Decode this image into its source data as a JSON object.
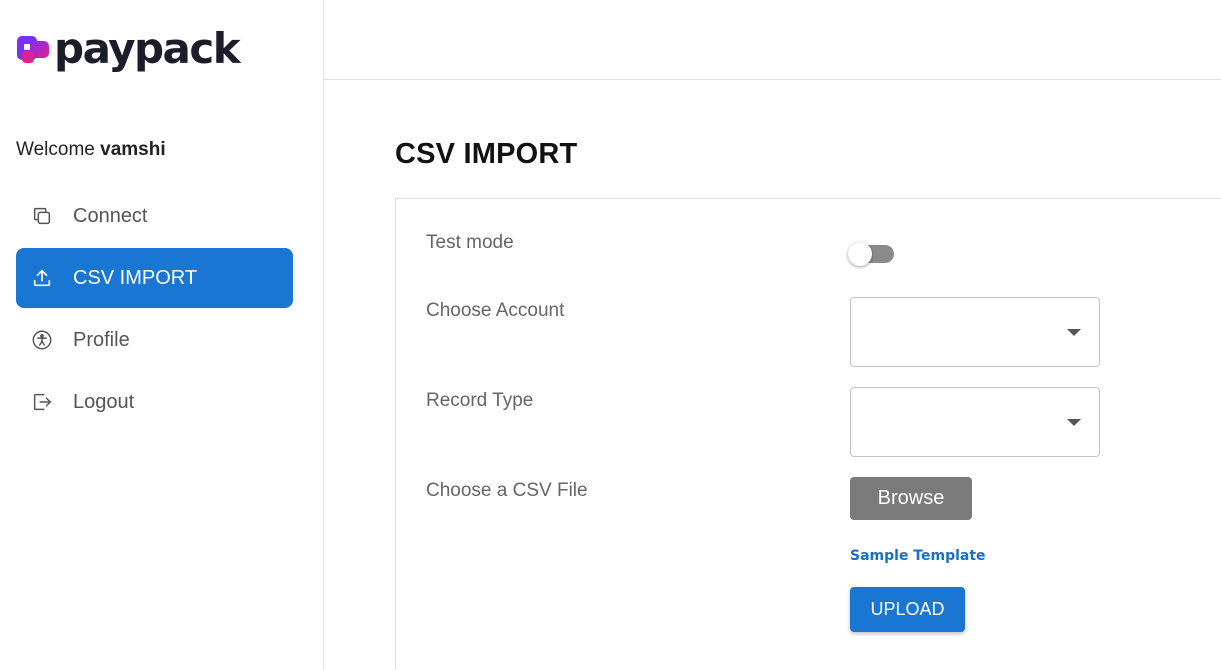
{
  "app": {
    "brand": "paypack"
  },
  "sidebar": {
    "welcome_prefix": "Welcome",
    "username": "vamshi",
    "items": [
      {
        "label": "Connect",
        "icon": "copy-icon",
        "active": false
      },
      {
        "label": "CSV IMPORT",
        "icon": "upload-icon",
        "active": true
      },
      {
        "label": "Profile",
        "icon": "accessibility-icon",
        "active": false
      },
      {
        "label": "Logout",
        "icon": "logout-icon",
        "active": false
      }
    ]
  },
  "main": {
    "title": "CSV IMPORT",
    "form": {
      "test_mode_label": "Test mode",
      "test_mode_on": false,
      "account_label": "Choose Account",
      "account_value": "",
      "record_type_label": "Record Type",
      "record_type_value": "",
      "file_label": "Choose a CSV File",
      "browse_label": "Browse",
      "sample_link": "Sample Template",
      "upload_label": "UPLOAD"
    }
  },
  "colors": {
    "accent": "#1976d2",
    "brand_pink": "#e0208c",
    "brand_purple": "#7b2ff7",
    "browse_button": "#7a7a7a",
    "link": "#1a6fc4"
  }
}
